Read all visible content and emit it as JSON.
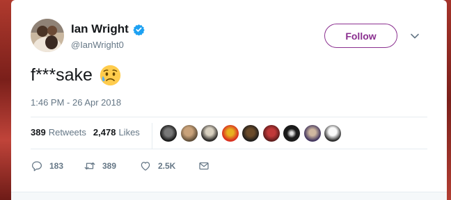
{
  "tweet": {
    "display_name": "Ian Wright",
    "handle": "@IanWright0",
    "follow_label": "Follow",
    "text": "f***sake",
    "timestamp": "1:46 PM - 26 Apr 2018"
  },
  "stats": {
    "retweets_count": "389",
    "retweets_label": "Retweets",
    "likes_count": "2,478",
    "likes_label": "Likes"
  },
  "actions": {
    "reply_count": "183",
    "retweet_count": "389",
    "like_count": "2.5K"
  },
  "likers_count": 9,
  "colors": {
    "follow_accent": "#8a2f8f",
    "verified": "#1da1f2",
    "secondary_text": "#657786",
    "primary_text": "#14171a"
  }
}
